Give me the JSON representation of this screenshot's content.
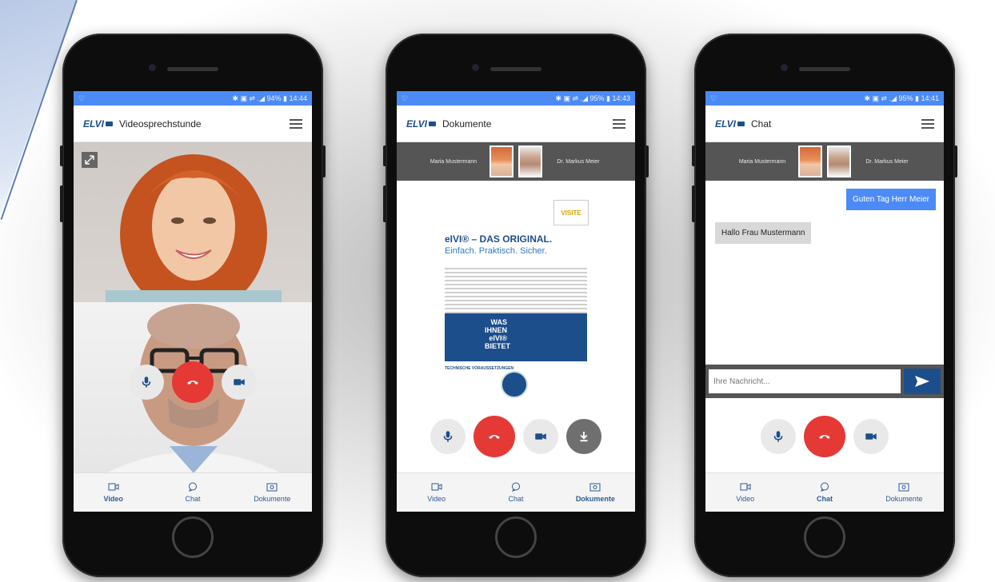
{
  "phones": [
    {
      "status": {
        "left": "♡",
        "right": "✱ ▣ ⇌ .◢ 94% ▮ 14:44"
      },
      "app_title": "Videosprechstunde",
      "tabs": [
        {
          "label": "Video"
        },
        {
          "label": "Chat"
        },
        {
          "label": "Dokumente"
        }
      ]
    },
    {
      "status": {
        "left": "♡",
        "right": "✱ ▣ ⇌ .◢ 95% ▮ 14:43"
      },
      "app_title": "Dokumente",
      "participants": {
        "left": "Maria Mustermann",
        "right": "Dr. Markus Meier"
      },
      "document": {
        "heading": "eIVI® – DAS ORIGINAL.",
        "subheading": "Einfach. Praktisch. Sicher.",
        "box_text": "WAS IHNEN eIVI® BIETET",
        "section_title": "TECHNISCHE VORAUSSETZUNGEN",
        "badge": "VISITE"
      },
      "tabs": [
        {
          "label": "Video"
        },
        {
          "label": "Chat"
        },
        {
          "label": "Dokumente"
        }
      ]
    },
    {
      "status": {
        "left": "♡",
        "right": "✱ ▣ ⇌ .◢ 95% ▮ 14:41"
      },
      "app_title": "Chat",
      "participants": {
        "left": "Maria Mustermann",
        "right": "Dr. Markus Meier"
      },
      "chat": {
        "outgoing": "Guten Tag Herr Meier",
        "incoming": "Hallo Frau Mustermann",
        "input_placeholder": "Ihre Nachricht..."
      },
      "tabs": [
        {
          "label": "Video"
        },
        {
          "label": "Chat"
        },
        {
          "label": "Dokumente"
        }
      ]
    }
  ],
  "logo_text": "ELVI",
  "icons": [
    "mic-icon",
    "hangup-icon",
    "camera-icon",
    "download-icon",
    "send-icon",
    "video-tab-icon",
    "chat-tab-icon",
    "documents-tab-icon",
    "menu-icon",
    "expand-icon"
  ],
  "colors": {
    "statusbar": "#4c8bf5",
    "brand": "#1c4e8c",
    "hangup": "#e53935",
    "participants_bar": "#555555"
  }
}
